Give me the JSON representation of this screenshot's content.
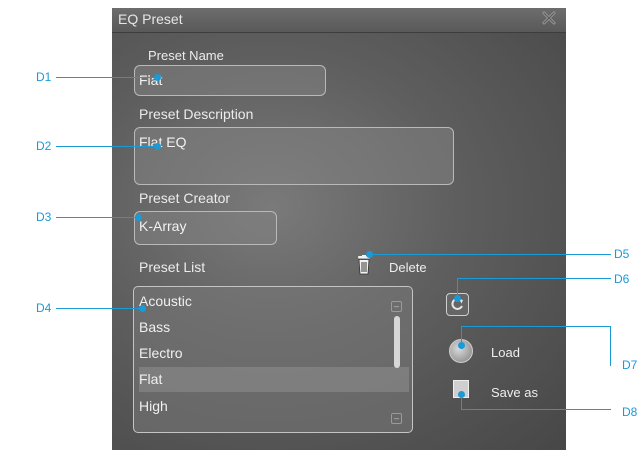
{
  "dialog": {
    "title": "EQ Preset",
    "preset_name_label": "Preset Name",
    "preset_name_value": "Flat",
    "preset_description_label": "Preset Description",
    "preset_description_value": "Flat EQ",
    "preset_creator_label": "Preset Creator",
    "preset_creator_value": "K-Array",
    "preset_list_label": "Preset List",
    "delete_label": "Delete",
    "load_label": "Load",
    "save_as_label": "Save as",
    "preset_list": [
      "Acoustic",
      "Bass",
      "Electro",
      "Flat",
      "High"
    ],
    "selected_preset": "Flat"
  },
  "callouts": {
    "d1": "D1",
    "d2": "D2",
    "d3": "D3",
    "d4": "D4",
    "d5": "D5",
    "d6": "D6",
    "d7": "D7",
    "d8": "D8"
  },
  "colors": {
    "callout": "#1a9ad6",
    "dialog_bg": "#5e5e5e"
  }
}
